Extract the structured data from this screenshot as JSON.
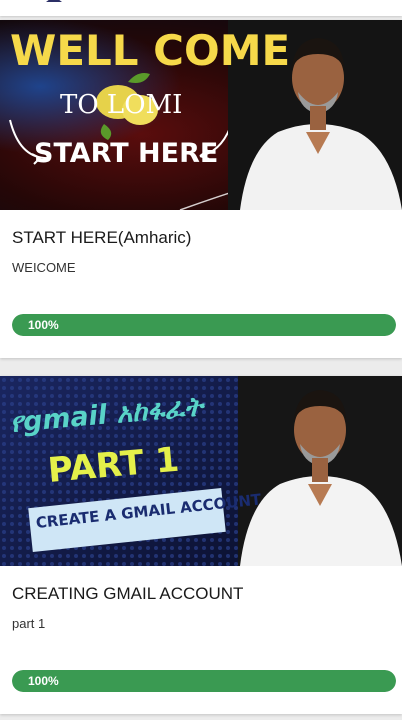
{
  "colors": {
    "progress_fill": "#3a9a52",
    "thumb1_title_yellow": "#f6d94a",
    "thumb2_text_teal": "#59d3c8",
    "thumb2_part_yellow": "#e4f04a"
  },
  "courses": [
    {
      "thumbnail": {
        "line1": "WELL COME",
        "line2": "TO LOMI",
        "line3": "START HERE"
      },
      "title": "START HERE(Amharic)",
      "description": "WEICOME",
      "progress_label": "100%",
      "progress": 1.0
    },
    {
      "thumbnail": {
        "line1": "የgmail አከፋፈት",
        "line2": "PART 1",
        "line3": "CREATE A GMAIL ACCOUNT"
      },
      "title": "CREATING GMAIL ACCOUNT",
      "description": "part 1",
      "progress_label": "100%",
      "progress": 1.0
    }
  ]
}
